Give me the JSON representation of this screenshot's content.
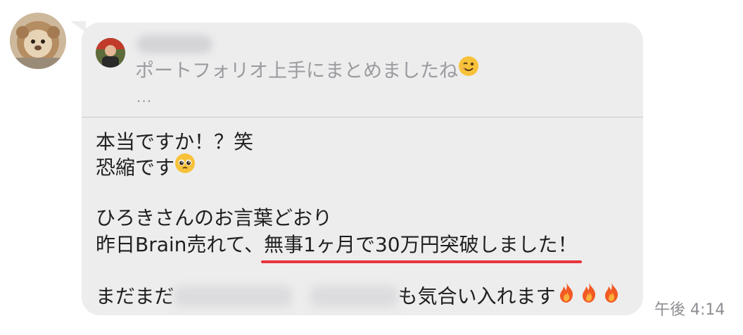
{
  "chat": {
    "timestamp": "午後 4:14",
    "colors": {
      "bubble": "#ededee",
      "underline": "#e8333b",
      "quote_text": "#9b9ba0"
    },
    "reply_quote": {
      "text": "ポートフォリオ上手にまとめましたね",
      "emoji": "winking-face-emoji",
      "more": "..."
    },
    "message": {
      "line1": "本当ですか！？笑",
      "line2": "恐縮です",
      "line2_emoji": "pleading-face-emoji",
      "line3": "ひろきさんのお言葉どおり",
      "line4_prefix": "昨日Brain売れて、",
      "line4_highlight": "無事1ヶ月で30万円突破しました！",
      "line5_prefix": "まだまだ",
      "line5_suffix": "も気合い入れます",
      "line5_emoji": "fire-emoji"
    }
  }
}
